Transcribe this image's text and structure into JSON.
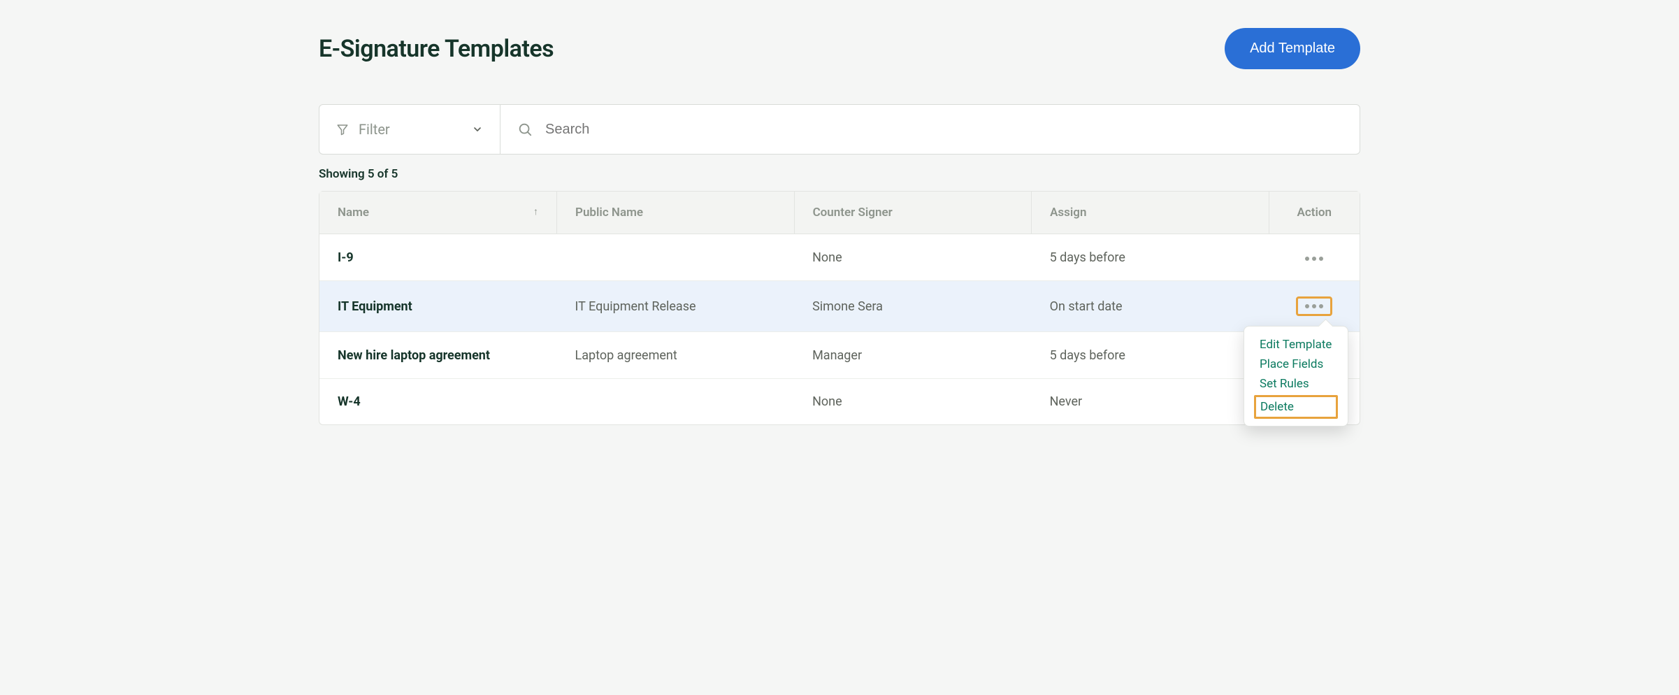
{
  "header": {
    "title": "E-Signature Templates",
    "add_button": "Add Template"
  },
  "controls": {
    "filter_label": "Filter",
    "search_placeholder": "Search"
  },
  "showing_text": "Showing 5 of 5",
  "table": {
    "headers": {
      "name": "Name",
      "public_name": "Public Name",
      "counter_signer": "Counter Signer",
      "assign": "Assign",
      "action": "Action"
    },
    "rows": [
      {
        "name": "I-9",
        "public_name": "",
        "counter_signer": "None",
        "assign": "5 days before"
      },
      {
        "name": "IT Equipment",
        "public_name": "IT Equipment Release",
        "counter_signer": "Simone Sera",
        "assign": "On start date"
      },
      {
        "name": "New hire laptop agreement",
        "public_name": "Laptop agreement",
        "counter_signer": "Manager",
        "assign": "5 days before"
      },
      {
        "name": "W-4",
        "public_name": "",
        "counter_signer": "None",
        "assign": "Never"
      }
    ]
  },
  "dropdown": {
    "edit": "Edit Template",
    "place": "Place Fields",
    "rules": "Set Rules",
    "delete": "Delete"
  }
}
